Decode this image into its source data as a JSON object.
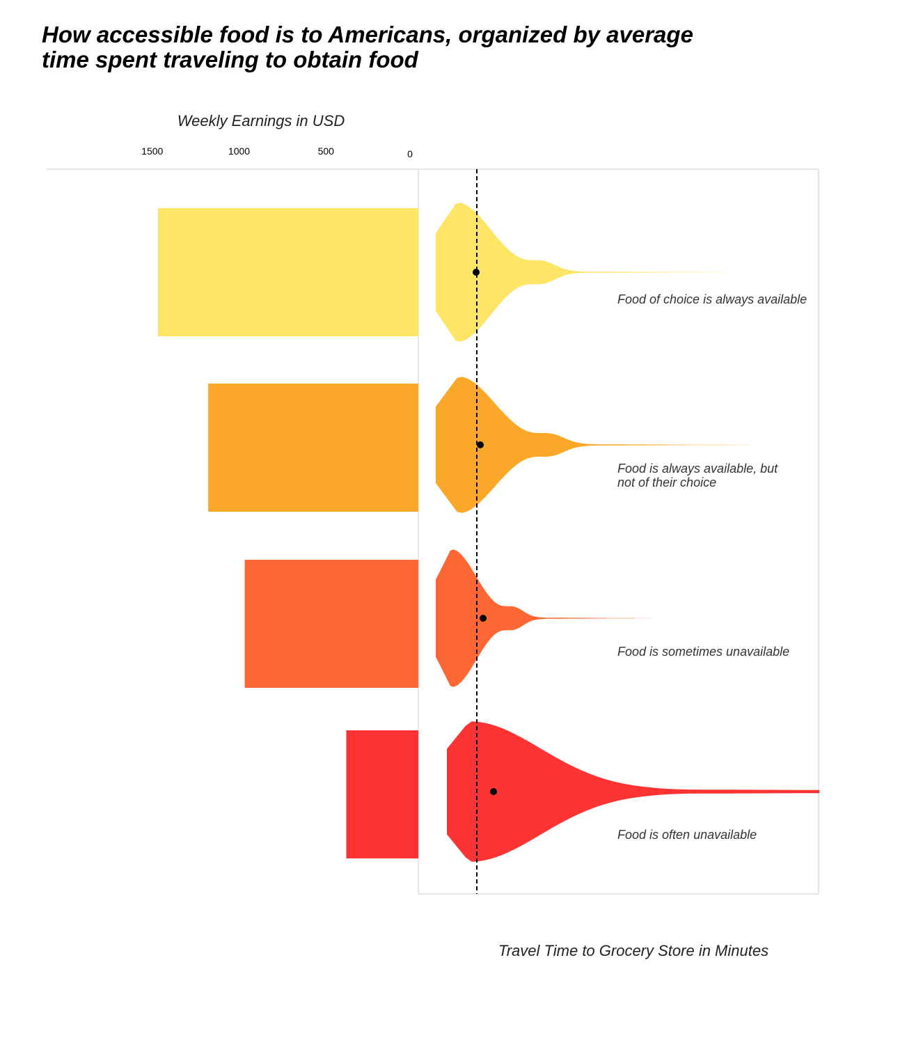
{
  "title_lines": [
    "How accessible food is to Americans, organized by average",
    "time spent traveling to obtain food"
  ],
  "chart_data": {
    "type": "bar",
    "title": "How accessible food is to Americans, organized by average time spent traveling to obtain food",
    "earnings_axis": {
      "label": "Weekly Earnings in USD",
      "ticks": [
        1500,
        1000,
        500,
        0
      ],
      "direction": "leftward"
    },
    "travel_axis": {
      "label": "Travel Time to Grocery Store in Minutes"
    },
    "categories": [
      {
        "label_lines": [
          "Food of choice is always available"
        ],
        "weekly_earnings": 1500,
        "color": "#FEE566",
        "mean_marker": 0.35,
        "violin": [
          [
            0.12,
            0
          ],
          [
            0.18,
            10
          ],
          [
            0.25,
            24
          ],
          [
            0.35,
            44
          ],
          [
            0.48,
            58
          ],
          [
            0.62,
            62
          ],
          [
            0.8,
            64
          ],
          [
            1.0,
            68
          ],
          [
            1.2,
            79
          ],
          [
            1.35,
            94
          ],
          [
            1.4,
            118
          ],
          [
            1.4,
            158
          ],
          [
            1.38,
            200
          ]
        ]
      },
      {
        "label_lines": [
          "Food is always available, but",
          "not of their choice"
        ],
        "weekly_earnings": 1210,
        "color": "#FBA72A",
        "mean_marker": 0.37,
        "violin": [
          [
            0.1,
            0
          ],
          [
            0.14,
            12
          ],
          [
            0.25,
            25
          ],
          [
            0.38,
            43
          ],
          [
            0.5,
            60
          ],
          [
            0.6,
            68
          ],
          [
            0.78,
            79
          ],
          [
            1.0,
            98
          ],
          [
            1.2,
            115
          ],
          [
            1.38,
            136
          ],
          [
            1.4,
            155
          ],
          [
            1.4,
            165
          ],
          [
            1.35,
            200
          ]
        ]
      },
      {
        "label_lines": [
          "Food is sometimes unavailable"
        ],
        "weekly_earnings": 1000,
        "color": "#FE6633",
        "mean_marker": 0.38,
        "violin": [
          [
            0.04,
            0
          ],
          [
            0.12,
            10
          ],
          [
            0.3,
            26
          ],
          [
            0.5,
            48
          ],
          [
            0.7,
            64
          ],
          [
            0.85,
            74
          ],
          [
            0.92,
            79
          ],
          [
            1.0,
            90
          ],
          [
            1.2,
            110
          ],
          [
            1.38,
            138
          ],
          [
            1.4,
            152
          ],
          [
            1.4,
            160
          ],
          [
            1.35,
            200
          ]
        ]
      },
      {
        "label_lines": [
          "Food is often unavailable"
        ],
        "weekly_earnings": 415,
        "color": "#FE3334",
        "mean_marker": 0.44,
        "violin": [
          [
            0.09,
            0
          ],
          [
            0.25,
            6
          ],
          [
            0.5,
            12
          ],
          [
            0.75,
            16
          ],
          [
            0.88,
            18
          ],
          [
            0.96,
            22
          ],
          [
            1.0,
            60
          ],
          [
            1.15,
            80
          ],
          [
            1.35,
            120
          ],
          [
            1.45,
            158
          ],
          [
            1.45,
            182
          ],
          [
            1.42,
            210
          ]
        ]
      }
    ],
    "reference_line": "dashed vertical line (overall average travel time)",
    "grid": false
  }
}
